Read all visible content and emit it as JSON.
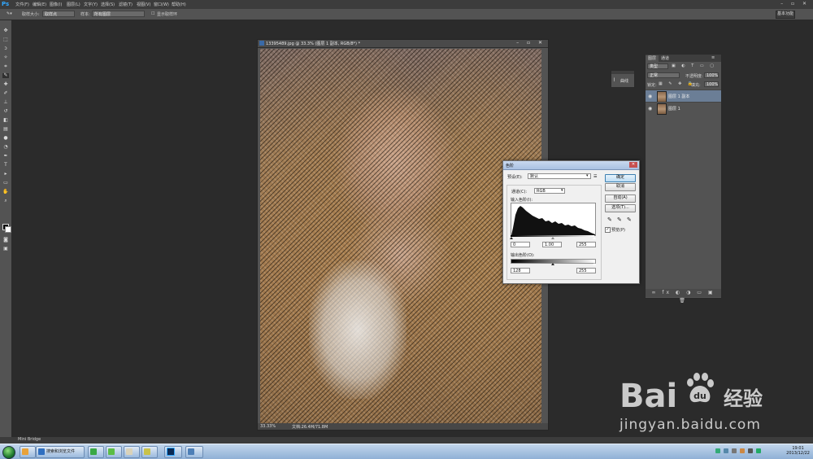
{
  "menubar": {
    "logo": "Ps",
    "items": [
      "文件(F)",
      "编辑(E)",
      "图像(I)",
      "图层(L)",
      "文字(Y)",
      "选择(S)",
      "滤镜(T)",
      "视图(V)",
      "窗口(W)",
      "帮助(H)"
    ]
  },
  "options": {
    "size_label": "取样大小:",
    "size_value": "取样点",
    "sample_label": "样本:",
    "sample_value": "所有图层",
    "ring_label": "显示取样环",
    "workspace": "基本功能"
  },
  "document": {
    "title": "13395489.jpg @ 33.3% (图层 1 副本, RGB/8*) *",
    "zoom": "33.33%",
    "docsize": "文档:26.4M/71.8M"
  },
  "mini_panel": {
    "label": "曲线"
  },
  "layers_panel": {
    "tabs": [
      "图层",
      "通道"
    ],
    "kind_label": "类型",
    "blend_mode": "正常",
    "opacity_label": "不透明度:",
    "opacity_value": "100%",
    "lock_label": "锁定:",
    "fill_label": "填充:",
    "fill_value": "100%",
    "layers": [
      {
        "name": "图层 1 副本",
        "selected": true
      },
      {
        "name": "图层 1",
        "selected": false
      }
    ]
  },
  "levels_dialog": {
    "title": "色阶",
    "preset_label": "预设(E):",
    "preset_value": "默认",
    "channel_label": "通道(C):",
    "channel_value": "RGB",
    "input_label": "输入色阶(I):",
    "input_black": "0",
    "input_gamma": "1.00",
    "input_white": "255",
    "output_label": "输出色阶(O):",
    "output_black": "128",
    "output_white": "255",
    "buttons": {
      "ok": "确定",
      "cancel": "取消",
      "auto": "自动(A)",
      "options": "选项(T)..."
    },
    "preview_label": "预览(P)",
    "preview_checked": true
  },
  "watermark": {
    "brand": "Bai",
    "product": "经验",
    "url": "jingyan.baidu.com"
  },
  "statusbar": {
    "mini_bridge": "Mini Bridge"
  },
  "taskbar": {
    "items": [
      "搜索和浏览文件"
    ],
    "clock_time": "19:01",
    "clock_date": "2013/12/22"
  }
}
